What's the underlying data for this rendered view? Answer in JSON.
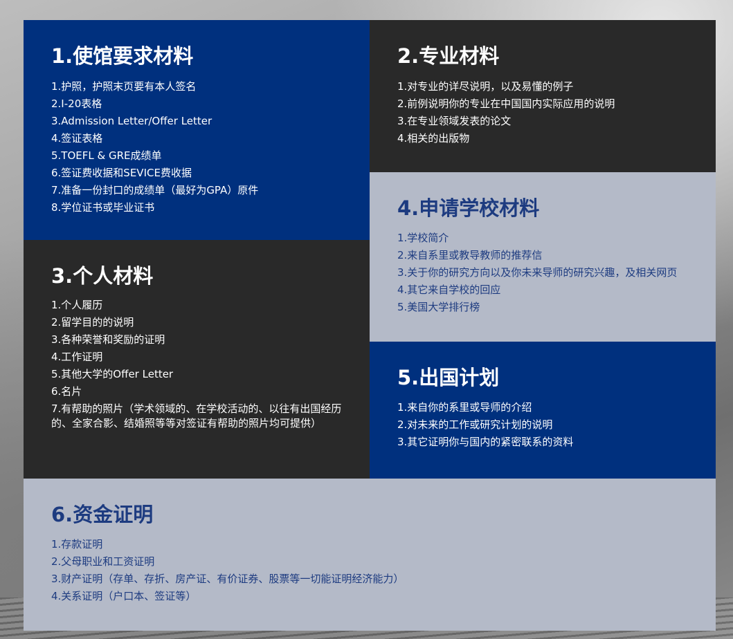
{
  "sections": [
    {
      "title": "1.使馆要求材料",
      "items": [
        "1.护照，护照末页要有本人签名",
        "2.I-20表格",
        "3.Admission Letter/Offer Letter",
        "4.签证表格",
        "5.TOEFL & GRE成绩单",
        "6.签证费收据和SEVICE费收据",
        "7.准备一份封口的成绩单（最好为GPA）原件",
        "8.学位证书或毕业证书"
      ]
    },
    {
      "title": "2.专业材料",
      "items": [
        "1.对专业的详尽说明，以及易懂的例子",
        "2.前例说明你的专业在中国国内实际应用的说明",
        "3.在专业领域发表的论文",
        "4.相关的出版物"
      ]
    },
    {
      "title": "3.个人材料",
      "items": [
        "1.个人履历",
        "2.留学目的的说明",
        "3.各种荣誉和奖励的证明",
        "4.工作证明",
        "5.其他大学的Offer Letter",
        "6.名片",
        "7.有帮助的照片（学术领域的、在学校活动的、以往有出国经历的、全家合影、结婚照等等对签证有帮助的照片均可提供）"
      ]
    },
    {
      "title": "4.申请学校材料",
      "items": [
        "1.学校简介",
        "2.来自系里或教导教师的推荐信",
        "3.关于你的研究方向以及你未来导师的研究兴趣，及相关网页",
        "4.其它来自学校的回应",
        "5.美国大学排行榜"
      ]
    },
    {
      "title": "5.出国计划",
      "items": [
        "1.来自你的系里或导师的介绍",
        "2.对未来的工作或研究计划的说明",
        "3.其它证明你与国内的紧密联系的资料"
      ]
    },
    {
      "title": "6.资金证明",
      "items": [
        "1.存款证明",
        "2.父母职业和工资证明",
        "3.财产证明（存单、存折、房产证、有价证券、股票等一切能证明经济能力）",
        "4.关系证明（户口本、签证等）"
      ]
    }
  ],
  "colors": {
    "blue": "#00307e",
    "dark": "#292929",
    "light": "#b4bac8",
    "light_text": "#1d3b80",
    "white_text": "#ffffff"
  }
}
